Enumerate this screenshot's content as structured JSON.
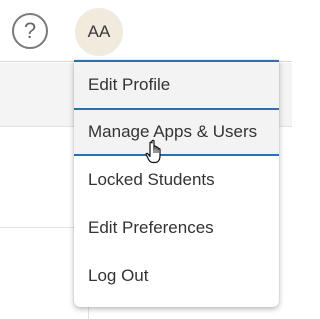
{
  "header": {
    "help_icon_glyph": "?",
    "avatar_initials": "AA"
  },
  "menu": {
    "items": [
      {
        "label": "Edit Profile"
      },
      {
        "label": "Manage Apps & Users"
      },
      {
        "label": "Locked Students"
      },
      {
        "label": "Edit Preferences"
      },
      {
        "label": "Log Out"
      }
    ],
    "hovered_item": "Manage Apps & Users"
  },
  "colors": {
    "accent": "#2a6fb0",
    "avatar_bg": "#f1ebdd",
    "hover_bg": "#f3f3f3"
  },
  "icons": {
    "help": "question-circle-icon",
    "cursor": "hand-pointer-icon"
  }
}
